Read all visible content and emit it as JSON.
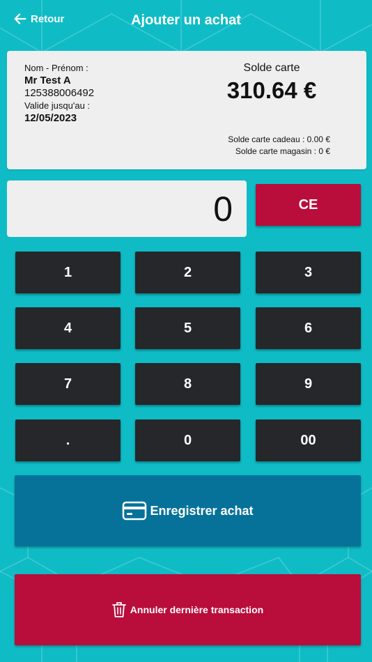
{
  "header": {
    "back_label": "Retour",
    "title": "Ajouter un achat"
  },
  "card": {
    "name_label": "Nom - Prénom :",
    "name_value": "Mr Test A",
    "card_number": "125388006492",
    "valid_label": "Valide jusqu'au :",
    "valid_value": "12/05/2023",
    "balance_label": "Solde carte",
    "balance_value": "310.64 €",
    "gift_balance": "Solde carte cadeau : 0.00 €",
    "store_balance": "Solde carte magasin : 0 €"
  },
  "display": {
    "value": "0"
  },
  "keypad": {
    "clear_label": "CE",
    "keys": [
      "1",
      "2",
      "3",
      "4",
      "5",
      "6",
      "7",
      "8",
      "9",
      ".",
      "0",
      "00"
    ]
  },
  "actions": {
    "save_label": "Enregistrer achat",
    "cancel_label": "Annuler dernière transaction"
  },
  "icons": {
    "back": "arrow-left-icon",
    "save": "credit-card-icon",
    "cancel": "trash-icon"
  },
  "colors": {
    "background": "#0fbcc6",
    "card": "#efefef",
    "key": "#25272b",
    "danger": "#b90d3c",
    "primary": "#06729a"
  }
}
